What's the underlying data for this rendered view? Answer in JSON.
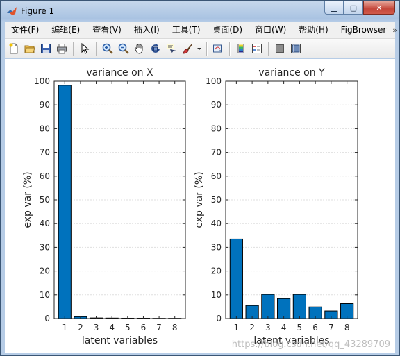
{
  "window": {
    "title": "Figure 1"
  },
  "menu": [
    "文件(F)",
    "编辑(E)",
    "查看(V)",
    "插入(I)",
    "工具(T)",
    "桌面(D)",
    "窗口(W)",
    "帮助(H)",
    "FigBrowser"
  ],
  "toolbar": [
    "new-figure-icon",
    "open-file-icon",
    "save-icon",
    "print-icon",
    "edit-plot-arrow-icon",
    "zoom-in-icon",
    "zoom-out-icon",
    "pan-hand-icon",
    "rotate-3d-icon",
    "data-cursor-icon",
    "brush-icon",
    "brush-dropdown-icon",
    "link-plot-icon",
    "insert-colorbar-icon",
    "insert-legend-icon",
    "hide-plot-tools-icon",
    "show-plot-tools-icon"
  ],
  "colors": {
    "bar": "#0072bd",
    "bar_edge": "#000000",
    "grid": "#dfdfdf",
    "axis": "#262626"
  },
  "watermark": "https://blog.csdn.net/qq_43289709",
  "chart_data": [
    {
      "type": "bar",
      "title": "variance on X",
      "xlabel": "latent variables",
      "ylabel": "exp var (%)",
      "categories": [
        "1",
        "2",
        "3",
        "4",
        "5",
        "6",
        "7",
        "8"
      ],
      "values": [
        98.3,
        0.8,
        0.25,
        0.2,
        0.15,
        0.15,
        0.1,
        0.1
      ],
      "ylim": [
        0,
        100
      ],
      "yticks": [
        "0",
        "10",
        "20",
        "30",
        "40",
        "50",
        "60",
        "70",
        "80",
        "90",
        "100"
      ],
      "grid": "horizontal"
    },
    {
      "type": "bar",
      "title": "variance on Y",
      "xlabel": "latent variables",
      "ylabel": "exp var (%)",
      "categories": [
        "1",
        "2",
        "3",
        "4",
        "5",
        "6",
        "7",
        "8"
      ],
      "values": [
        33.5,
        5.5,
        10.2,
        8.4,
        10.2,
        4.9,
        3.2,
        6.3
      ],
      "ylim": [
        0,
        100
      ],
      "yticks": [
        "0",
        "10",
        "20",
        "30",
        "40",
        "50",
        "60",
        "70",
        "80",
        "90",
        "100"
      ],
      "grid": "horizontal"
    }
  ]
}
